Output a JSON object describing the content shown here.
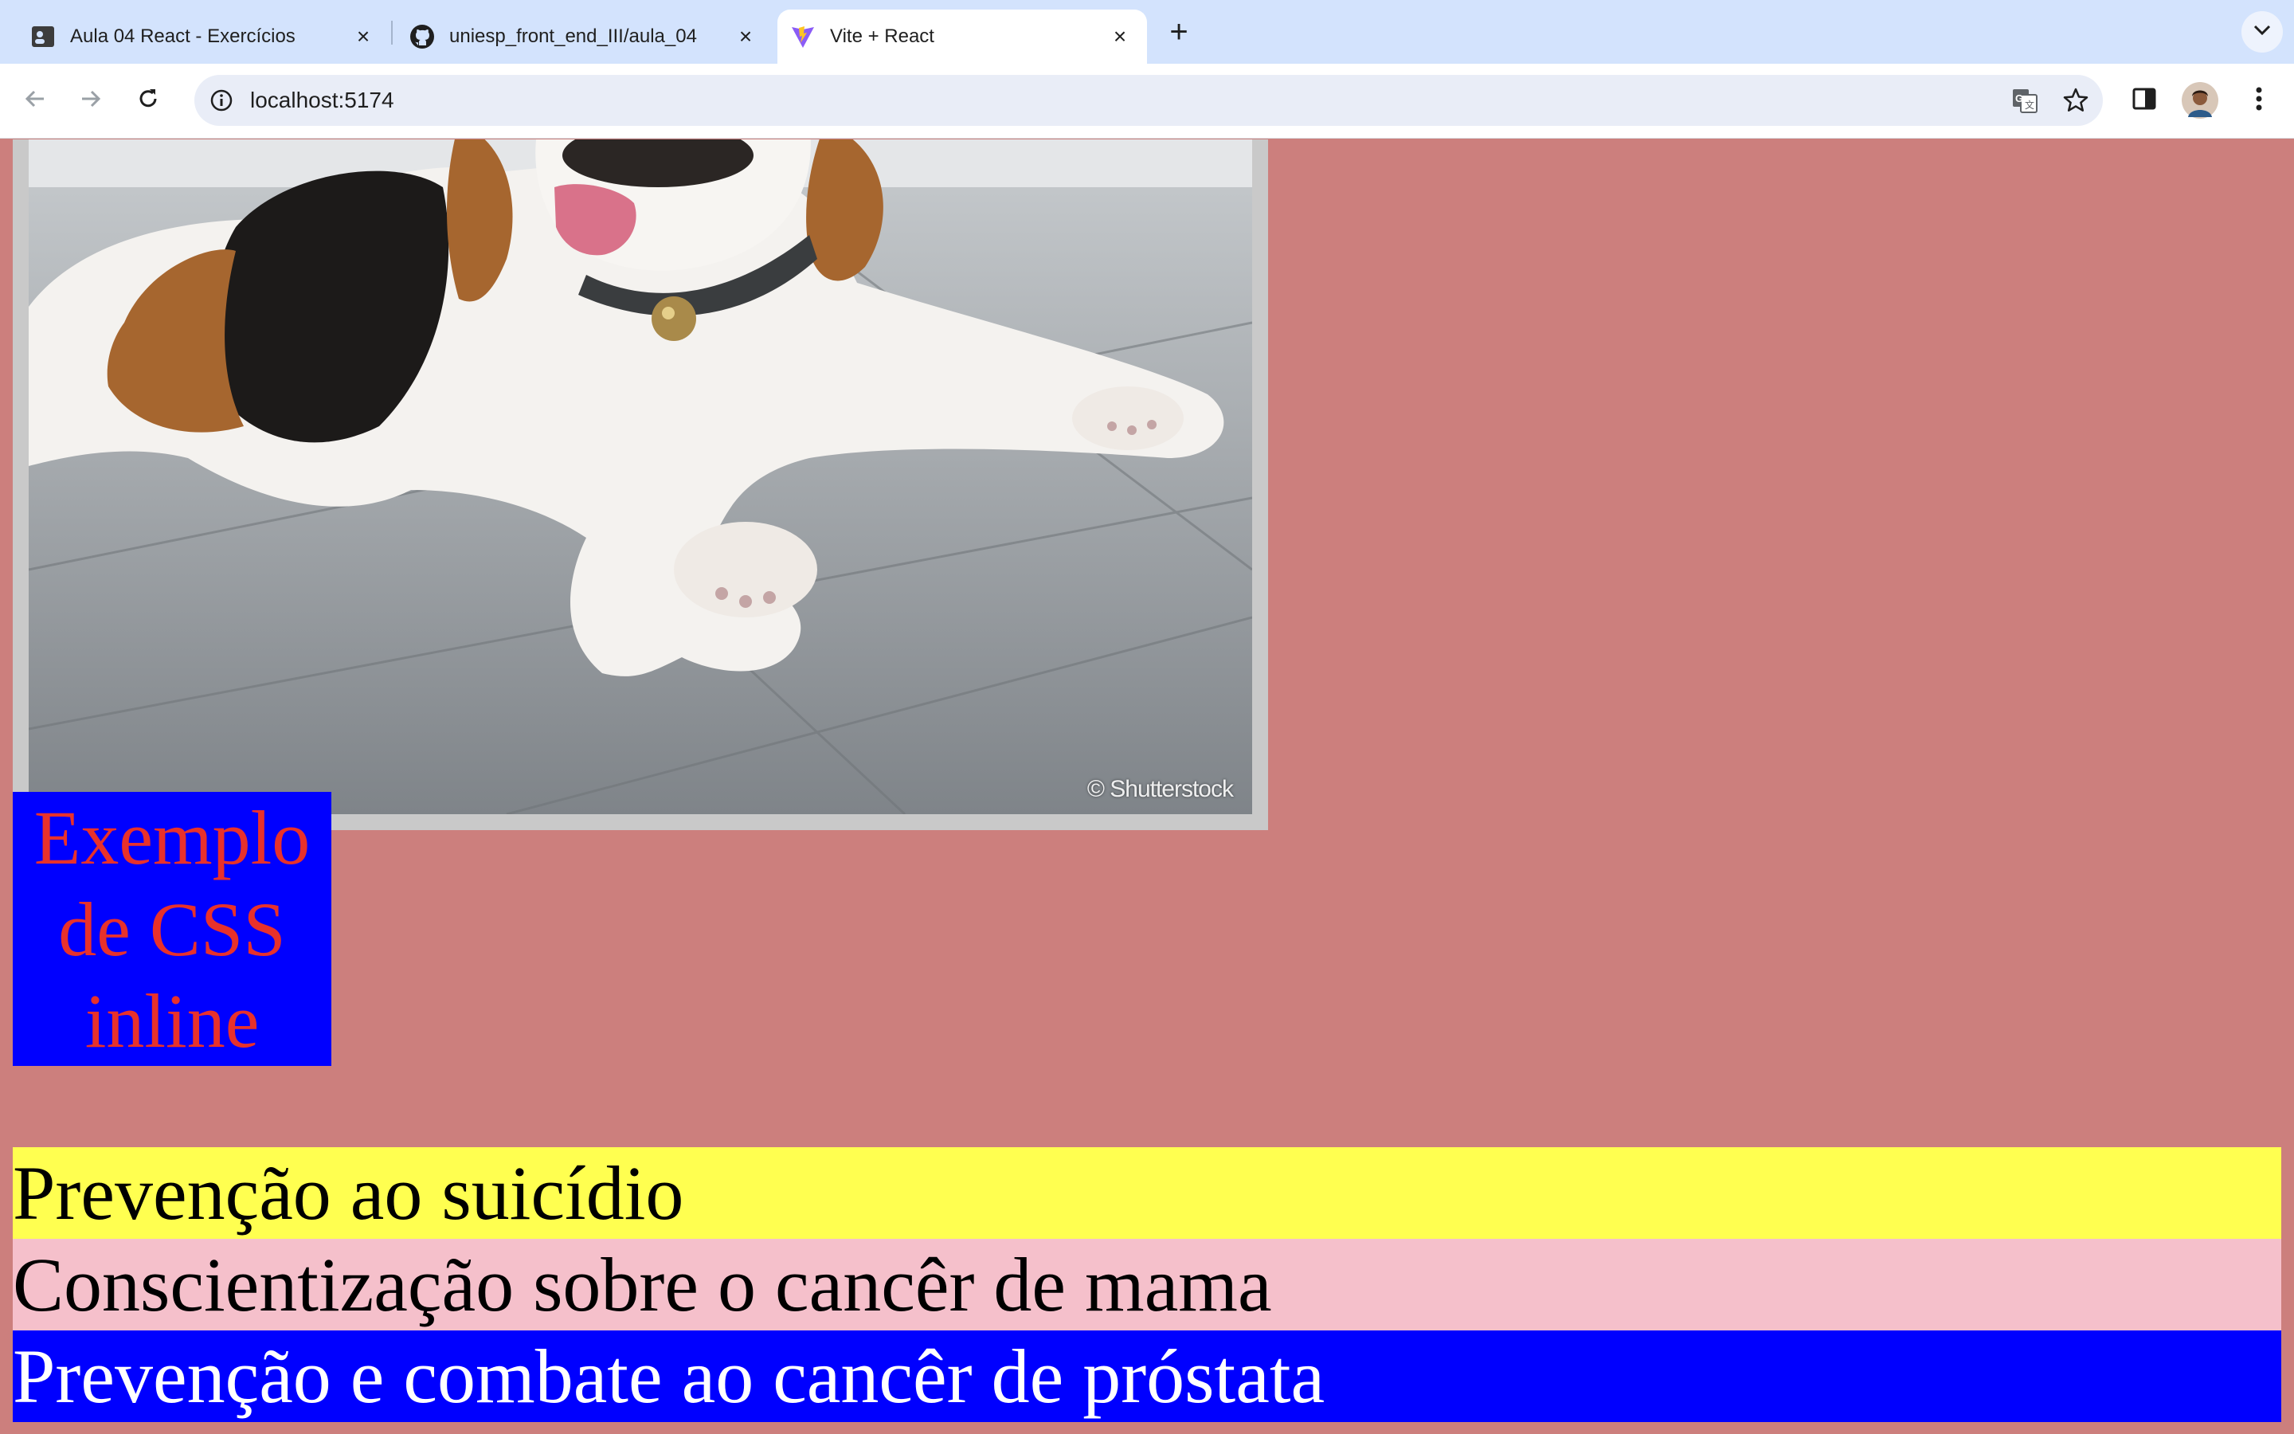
{
  "tabs": [
    {
      "title": "Aula 04 React - Exercícios",
      "icon": "document-icon",
      "active": false
    },
    {
      "title": "uniesp_front_end_III/aula_04",
      "icon": "github-icon",
      "active": false
    },
    {
      "title": "Vite + React",
      "icon": "vite-icon",
      "active": true
    }
  ],
  "toolbar": {
    "url": "localhost:5174"
  },
  "page": {
    "image_watermark": "© Shutterstock",
    "css_box_text": "Exemplo de CSS inline",
    "bands": [
      "Prevenção ao suicídio",
      "Conscientização sobre o cancêr de mama",
      "Prevenção e combate ao cancêr de próstata"
    ]
  },
  "colors": {
    "page_background": "#cc7f7d",
    "css_box_background": "#0000ff",
    "css_box_text": "#e8312b",
    "band_yellow": "#ffff50",
    "band_pink": "#f5c0cb",
    "band_blue": "#0000ff"
  }
}
